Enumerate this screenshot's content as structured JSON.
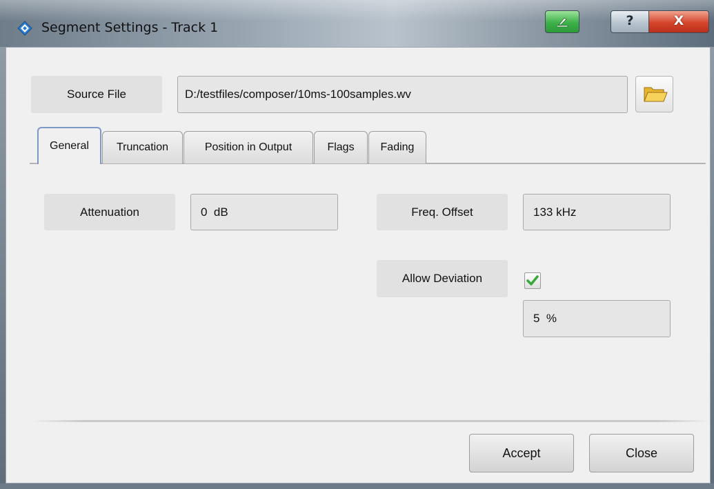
{
  "window": {
    "title": "Segment Settings - Track 1",
    "icon": "rs-diamond-icon",
    "controls": {
      "green_button_icon": "save-icon",
      "help_label": "?",
      "close_label": "X"
    }
  },
  "source": {
    "label": "Source File",
    "path": "D:/testfiles/composer/10ms-100samples.wv",
    "browse_icon": "folder-icon"
  },
  "tabs": [
    {
      "label": "General",
      "active": true
    },
    {
      "label": "Truncation",
      "active": false
    },
    {
      "label": "Position in Output",
      "active": false
    },
    {
      "label": "Flags",
      "active": false
    },
    {
      "label": "Fading",
      "active": false
    }
  ],
  "general": {
    "attenuation_label": "Attenuation",
    "attenuation_value": "0  dB",
    "freq_offset_label": "Freq. Offset",
    "freq_offset_value": "133 kHz",
    "allow_deviation_label": "Allow Deviation",
    "allow_deviation_checked": true,
    "deviation_value": "5  %"
  },
  "footer": {
    "accept_label": "Accept",
    "close_label": "Close"
  },
  "colors": {
    "accent_tab": "#7c97c8",
    "check_green": "#37a83a",
    "close_red": "#d6452b"
  }
}
